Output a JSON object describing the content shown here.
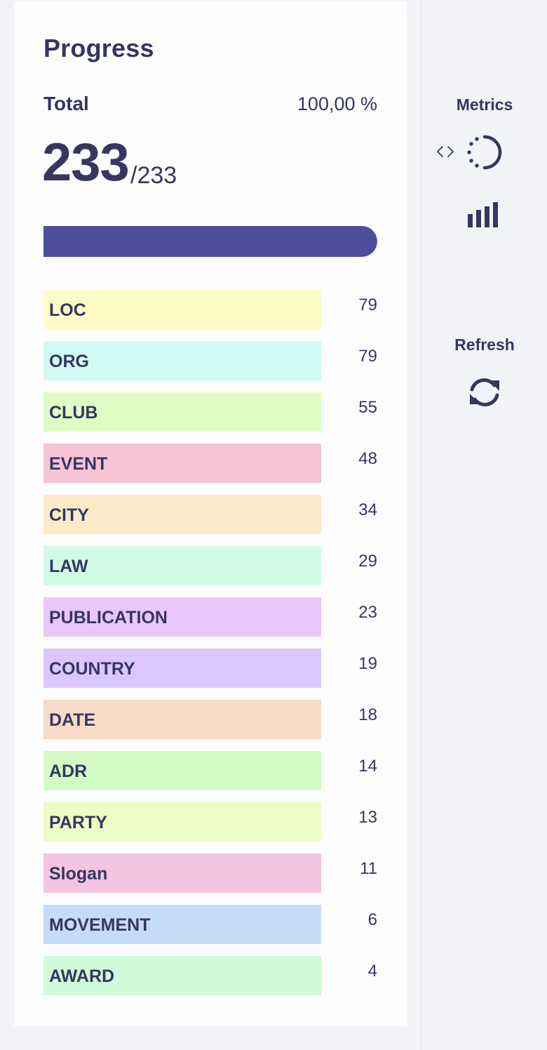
{
  "progress": {
    "title": "Progress",
    "total_label": "Total",
    "total_percent": "100,00 %",
    "completed": "233",
    "total": "/233",
    "fill_fraction": 1.0,
    "bar_color": "#4d4f9c"
  },
  "labels": [
    {
      "name": "LOC",
      "count": "79",
      "color": "#fefbc7"
    },
    {
      "name": "ORG",
      "count": "79",
      "color": "#d1fbf5"
    },
    {
      "name": "CLUB",
      "count": "55",
      "color": "#dffec6"
    },
    {
      "name": "EVENT",
      "count": "48",
      "color": "#f6c4d4"
    },
    {
      "name": "CITY",
      "count": "34",
      "color": "#fcebc8"
    },
    {
      "name": "LAW",
      "count": "29",
      "color": "#d0fce7"
    },
    {
      "name": "PUBLICATION",
      "count": "23",
      "color": "#e9c6fb"
    },
    {
      "name": "COUNTRY",
      "count": "19",
      "color": "#dbc7fb"
    },
    {
      "name": "DATE",
      "count": "18",
      "color": "#f7dbc6"
    },
    {
      "name": "ADR",
      "count": "14",
      "color": "#d3fcc5"
    },
    {
      "name": "PARTY",
      "count": "13",
      "color": "#edfcc6"
    },
    {
      "name": "Slogan",
      "count": "11",
      "color": "#f5c4e1"
    },
    {
      "name": "MOVEMENT",
      "count": "6",
      "color": "#c5dbf8"
    },
    {
      "name": "AWARD",
      "count": "4",
      "color": "#cefbd8"
    }
  ],
  "sidebar": {
    "metrics_label": "Metrics",
    "refresh_label": "Refresh",
    "icons": [
      "code-icon",
      "loading-spinner-icon",
      "bar-chart-icon",
      "refresh-icon"
    ]
  }
}
